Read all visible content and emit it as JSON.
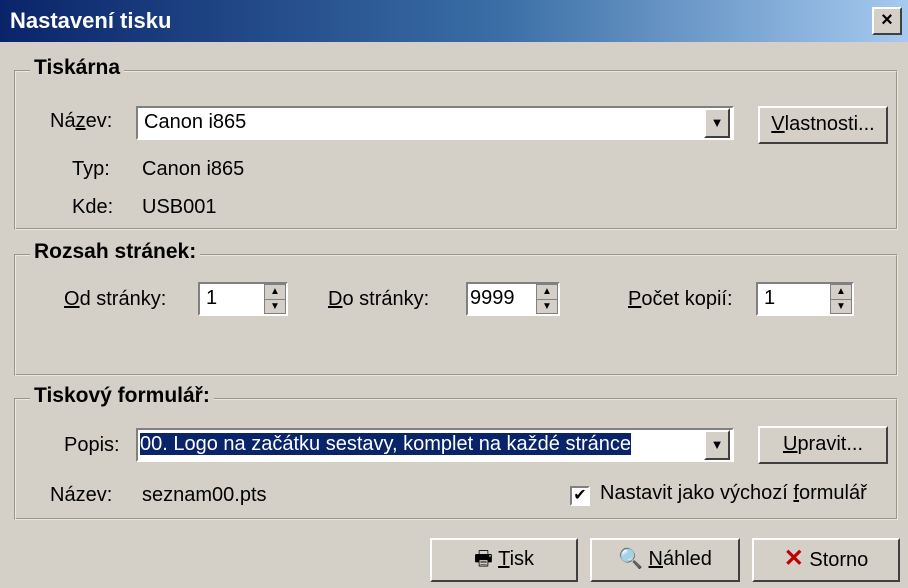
{
  "window": {
    "title": "Nastavení tisku",
    "close_label": "×"
  },
  "printer": {
    "legend": "Tiskárna",
    "name_label": "Název:",
    "name_value": "Canon i865",
    "properties_button": "Vlastnosti...",
    "type_label": "Typ:",
    "type_value": "Canon i865",
    "where_label": "Kde:",
    "where_value": "USB001"
  },
  "range": {
    "legend": "Rozsah stránek:",
    "from_label": "Od stránky:",
    "from_value": "1",
    "to_label": "Do stránky:",
    "to_value": "9999",
    "copies_label": "Počet kopií:",
    "copies_value": "1"
  },
  "form": {
    "legend": "Tiskový formulář:",
    "desc_label": "Popis:",
    "desc_value": "00. Logo na začátku sestavy, komplet na každé stránce",
    "edit_button": "Upravit...",
    "name_label": "Název:",
    "name_value": "seznam00.pts",
    "default_checkbox": "Nastavit jako výchozí formulář",
    "default_checked": "✔"
  },
  "buttons": {
    "print": "Tisk",
    "preview": "Náhled",
    "cancel": "Storno"
  }
}
